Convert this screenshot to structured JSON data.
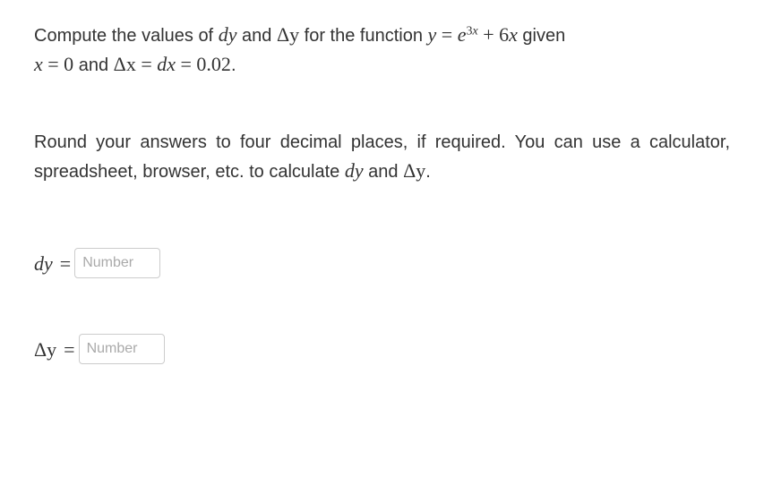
{
  "problem": {
    "line1_prefix": "Compute the values of ",
    "dy": "dy",
    "and1": " and ",
    "Delta_y": "Δy",
    "for_function": " for the function ",
    "eq_y": "y",
    "equals1": " = ",
    "e": "e",
    "exp_3": "3",
    "exp_x": "x",
    "plus": " + ",
    "six": "6",
    "x1": "x",
    "given": " given",
    "line2_x": "x",
    "line2_eq0": " = 0",
    "line2_and": " and ",
    "line2_Dx": "Δx",
    "line2_eq": " = ",
    "line2_dx": "dx",
    "line2_eqv": " = 0.02",
    "period": "."
  },
  "instructions": {
    "text1": "Round your answers to four decimal places, if required. You can use a calculator, spreadsheet, browser, etc. to calculate ",
    "dy": "dy",
    "and": " and ",
    "Dy": "Δy",
    "period": "."
  },
  "answers": {
    "dy": {
      "label": "dy",
      "equals": "=",
      "placeholder": "Number",
      "value": ""
    },
    "Dy": {
      "label": "Δy",
      "equals": "=",
      "placeholder": "Number",
      "value": ""
    }
  }
}
